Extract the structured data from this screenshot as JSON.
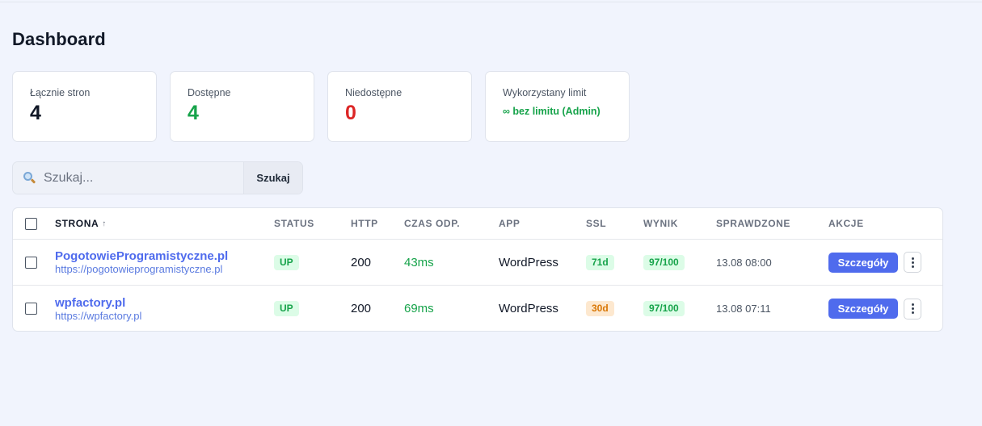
{
  "page": {
    "title": "Dashboard"
  },
  "stats": [
    {
      "label": "Łącznie stron",
      "value": "4"
    },
    {
      "label": "Dostępne",
      "value": "4"
    },
    {
      "label": "Niedostępne",
      "value": "0"
    },
    {
      "label": "Wykorzystany limit",
      "value": "∞ bez limitu (Admin)"
    }
  ],
  "search": {
    "placeholder": "Szukaj...",
    "value": "",
    "button_label": "Szukaj",
    "icon": "search-icon"
  },
  "table": {
    "headers": {
      "site": "STRONA",
      "sort_indicator": "↑",
      "status": "STATUS",
      "http": "HTTP",
      "response_time": "CZAS ODP.",
      "app": "APP",
      "ssl": "SSL",
      "score": "WYNIK",
      "checked": "SPRAWDZONE",
      "actions": "AKCJE"
    },
    "rows": [
      {
        "name": "PogotowieProgramistyczne.pl",
        "url": "https://pogotowieprogramistyczne.pl",
        "status": "UP",
        "http": "200",
        "response_time": "43ms",
        "app": "WordPress",
        "ssl": "71d",
        "score": "97/100",
        "checked": "13.08 08:00",
        "details_label": "Szczegóły"
      },
      {
        "name": "wpfactory.pl",
        "url": "https://wpfactory.pl",
        "status": "UP",
        "http": "200",
        "response_time": "69ms",
        "app": "WordPress",
        "ssl": "30d",
        "score": "97/100",
        "checked": "13.08 07:11",
        "details_label": "Szczegóły"
      }
    ]
  },
  "colors": {
    "accent": "#4f6bed",
    "success": "#16a34a",
    "danger": "#dc2626",
    "warning": "#d97706",
    "background": "#f1f4fd"
  }
}
